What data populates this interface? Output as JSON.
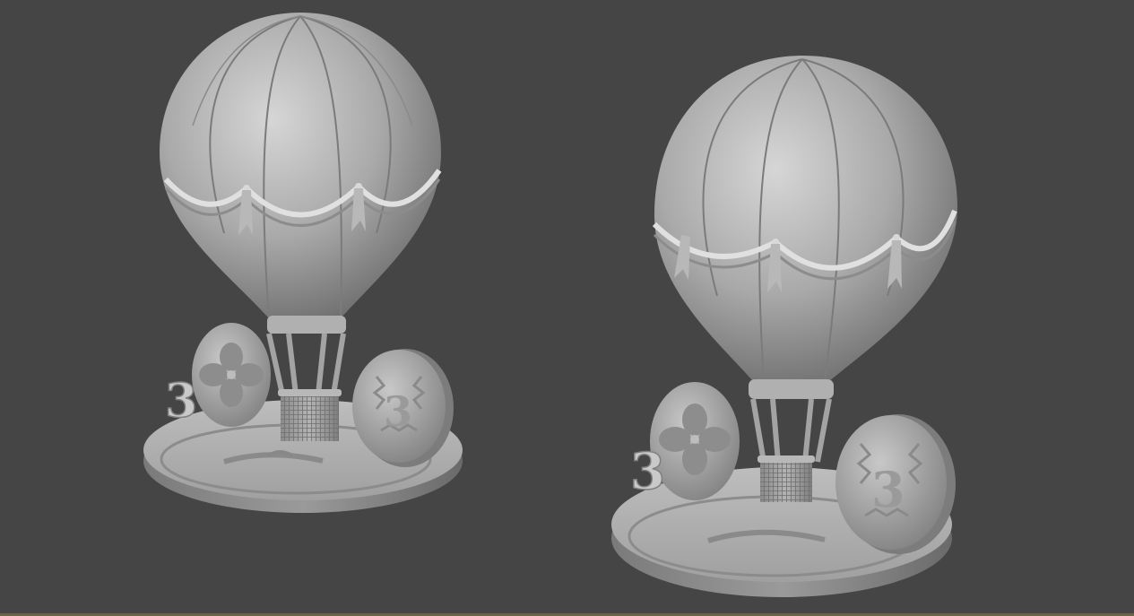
{
  "viewport": {
    "background": "#454545",
    "bottom_edge_color": "#6b6248"
  },
  "models": [
    {
      "name": "hot-air-balloon-model-left",
      "material": "#9a9a9a",
      "digit": "3"
    },
    {
      "name": "hot-air-balloon-model-right",
      "material": "#9a9a9a",
      "digit": "3"
    }
  ]
}
